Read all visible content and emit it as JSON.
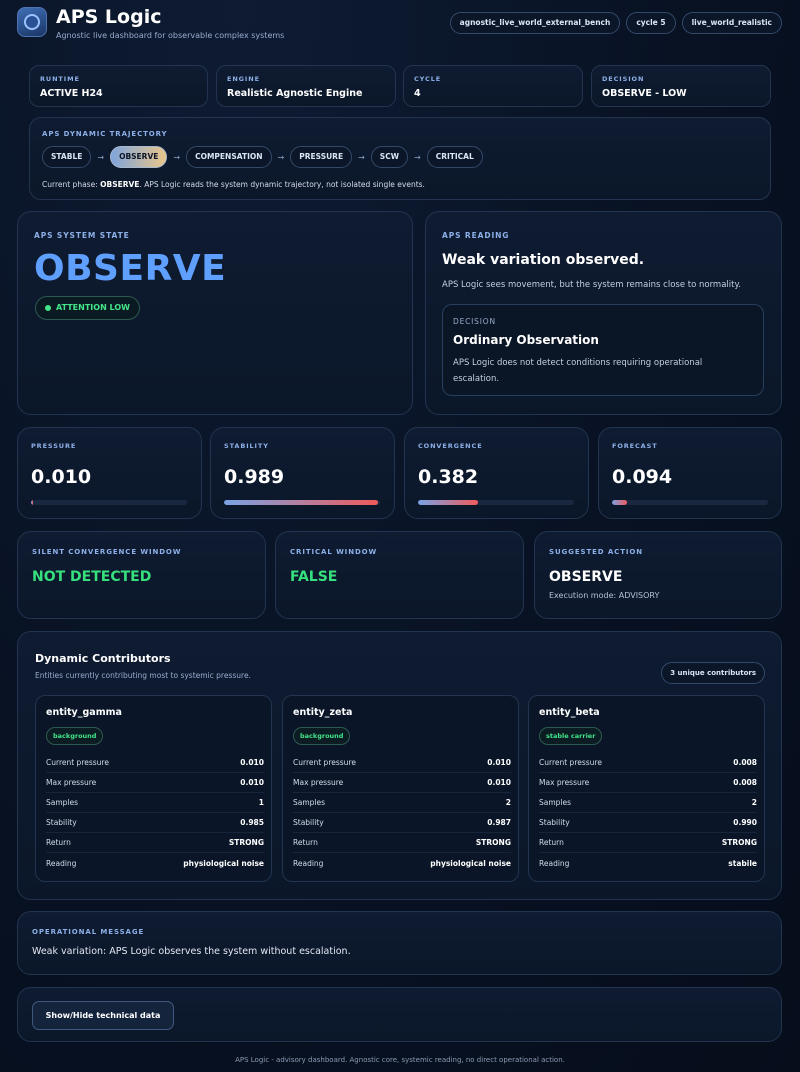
{
  "header": {
    "title": "APS Logic",
    "subtitle": "Agnostic live dashboard for observable complex systems",
    "pills": [
      "agnostic_live_world_external_bench",
      "cycle 5",
      "live_world_realistic"
    ]
  },
  "info_cards": [
    {
      "label": "RUNTIME",
      "value": "ACTIVE H24"
    },
    {
      "label": "ENGINE",
      "value": "Realistic Agnostic Engine"
    },
    {
      "label": "CYCLE",
      "value": "4"
    },
    {
      "label": "DECISION",
      "value": "OBSERVE - LOW"
    }
  ],
  "trajectory": {
    "label": "APS DYNAMIC TRAJECTORY",
    "steps": [
      "STABLE",
      "OBSERVE",
      "COMPENSATION",
      "PRESSURE",
      "SCW",
      "CRITICAL"
    ],
    "active_step": "OBSERVE",
    "arrow": "→",
    "phase_prefix": "Current phase:",
    "phase_value": "OBSERVE",
    "phase_suffix": ". APS Logic reads the system dynamic trajectory, not isolated single events."
  },
  "system_state": {
    "label": "APS SYSTEM STATE",
    "state": "OBSERVE",
    "attention": "ATTENTION LOW",
    "state_color": "#5fa0ff",
    "attention_color": "#42e58a"
  },
  "reading": {
    "label": "APS READING",
    "title": "Weak variation observed.",
    "text": "APS Logic sees movement, but the system remains close to normality.",
    "decision_label": "DECISION",
    "decision_title": "Ordinary Observation",
    "decision_text": "APS Logic does not detect conditions requiring operational escalation."
  },
  "metrics": [
    {
      "label": "PRESSURE",
      "value": "0.010",
      "fill": 0.01
    },
    {
      "label": "STABILITY",
      "value": "0.989",
      "fill": 0.989
    },
    {
      "label": "CONVERGENCE",
      "value": "0.382",
      "fill": 0.382
    },
    {
      "label": "FORECAST",
      "value": "0.094",
      "fill": 0.094
    }
  ],
  "windows": {
    "silent": {
      "label": "SILENT CONVERGENCE WINDOW",
      "value": "NOT DETECTED"
    },
    "critical": {
      "label": "CRITICAL WINDOW",
      "value": "FALSE"
    },
    "action": {
      "label": "SUGGESTED ACTION",
      "value": "OBSERVE",
      "sub": "Execution mode: ADVISORY"
    }
  },
  "contributors": {
    "title": "Dynamic Contributors",
    "subtitle": "Entities currently contributing most to systemic pressure.",
    "count": "3 unique contributors",
    "row_labels": [
      "Current pressure",
      "Max pressure",
      "Samples",
      "Stability",
      "Return",
      "Reading"
    ],
    "entities": [
      {
        "name": "entity_gamma",
        "tag": "background",
        "values": [
          "0.010",
          "0.010",
          "1",
          "0.985",
          "STRONG",
          "physiological noise"
        ]
      },
      {
        "name": "entity_zeta",
        "tag": "background",
        "values": [
          "0.010",
          "0.010",
          "2",
          "0.987",
          "STRONG",
          "physiological noise"
        ]
      },
      {
        "name": "entity_beta",
        "tag": "stable carrier",
        "values": [
          "0.008",
          "0.008",
          "2",
          "0.990",
          "STRONG",
          "stabile"
        ]
      }
    ]
  },
  "operational": {
    "label": "OPERATIONAL MESSAGE",
    "message": "Weak variation: APS Logic observes the system without escalation."
  },
  "tech_button": "Show/Hide technical data",
  "footer": "APS Logic - advisory dashboard. Agnostic core, systemic reading, no direct operational action."
}
